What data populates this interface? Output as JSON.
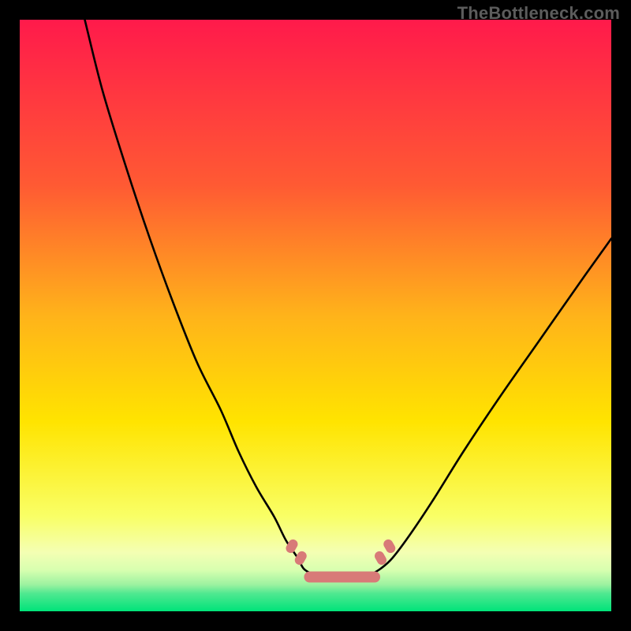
{
  "watermark": "TheBottleneck.com",
  "chart_data": {
    "type": "line",
    "title": "",
    "xlabel": "",
    "ylabel": "",
    "xlim": [
      0,
      100
    ],
    "ylim": [
      0,
      100
    ],
    "grid": false,
    "background_gradient": {
      "top": "#ff1a4b",
      "mid_upper": "#ff8a2a",
      "mid": "#ffe400",
      "mid_lower": "#f6ff66",
      "bottom": "#00e37a"
    },
    "annotations": {
      "trough_markers": {
        "color": "#d87a78",
        "x_range": [
          47,
          62
        ],
        "side_ticks_x": [
          46,
          47.5,
          61,
          62.5
        ],
        "side_ticks_y": [
          9,
          11
        ]
      }
    },
    "series": [
      {
        "name": "left-branch",
        "x": [
          11,
          14,
          18,
          22,
          26,
          30,
          34,
          37,
          40,
          43,
          45,
          47,
          48,
          49.5,
          51
        ],
        "y": [
          100,
          88,
          75,
          63,
          52,
          42,
          34,
          27,
          21,
          16,
          12,
          9,
          7.2,
          6.3,
          6
        ]
      },
      {
        "name": "trough",
        "x": [
          51,
          53,
          55,
          57,
          59
        ],
        "y": [
          6,
          5.8,
          5.7,
          5.8,
          6
        ]
      },
      {
        "name": "right-branch",
        "x": [
          59,
          61,
          63,
          66,
          70,
          75,
          81,
          88,
          95,
          100
        ],
        "y": [
          6,
          7.2,
          9,
          13,
          19,
          27,
          36,
          46,
          56,
          63
        ]
      }
    ]
  }
}
